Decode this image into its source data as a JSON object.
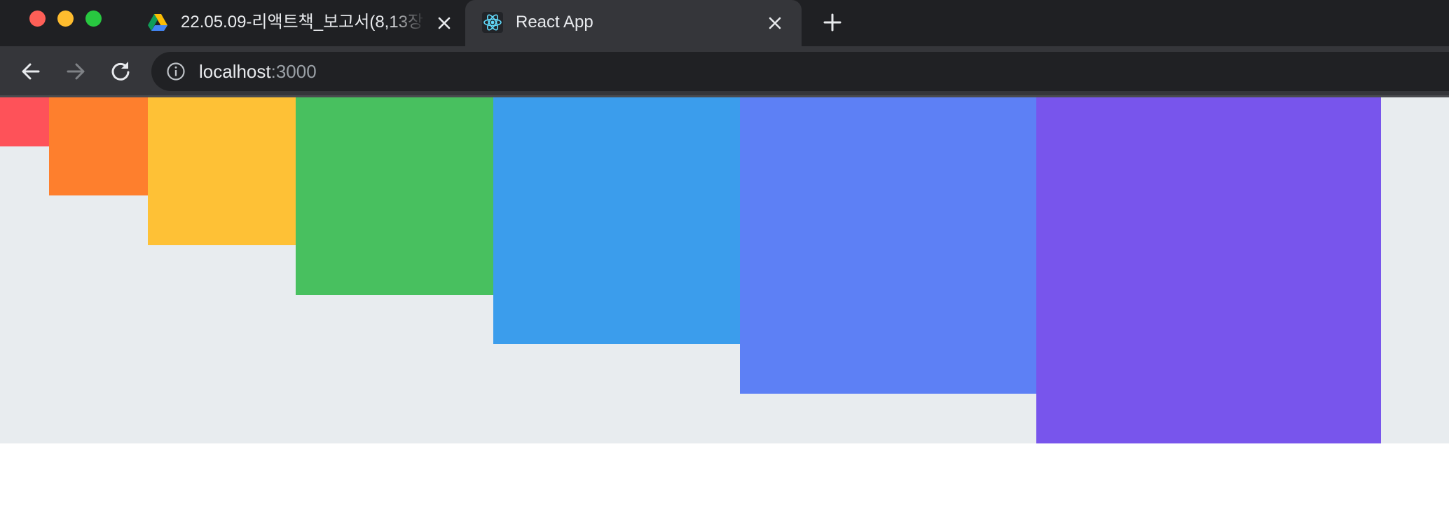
{
  "tabs": [
    {
      "title": "22.05.09-리액트책_보고서(8,13장",
      "favicon": "google-drive-icon",
      "active": false
    },
    {
      "title": "React App",
      "favicon": "react-logo-icon",
      "active": true
    }
  ],
  "toolbar": {
    "url_host": "localhost",
    "url_port": ":3000",
    "site_info_icon": "info-circle-icon",
    "back_icon": "arrow-left-icon",
    "forward_icon": "arrow-right-icon",
    "reload_icon": "reload-icon"
  },
  "colors": {
    "traffic_close": "#fe5f57",
    "traffic_minimize": "#febc2e",
    "traffic_maximize": "#28c840",
    "page_background": "#e8ecef",
    "boxes": [
      "#fe5259",
      "#fe7f2d",
      "#fec136",
      "#48c05f",
      "#3b9dec",
      "#5d80f5",
      "#7855ec"
    ]
  }
}
